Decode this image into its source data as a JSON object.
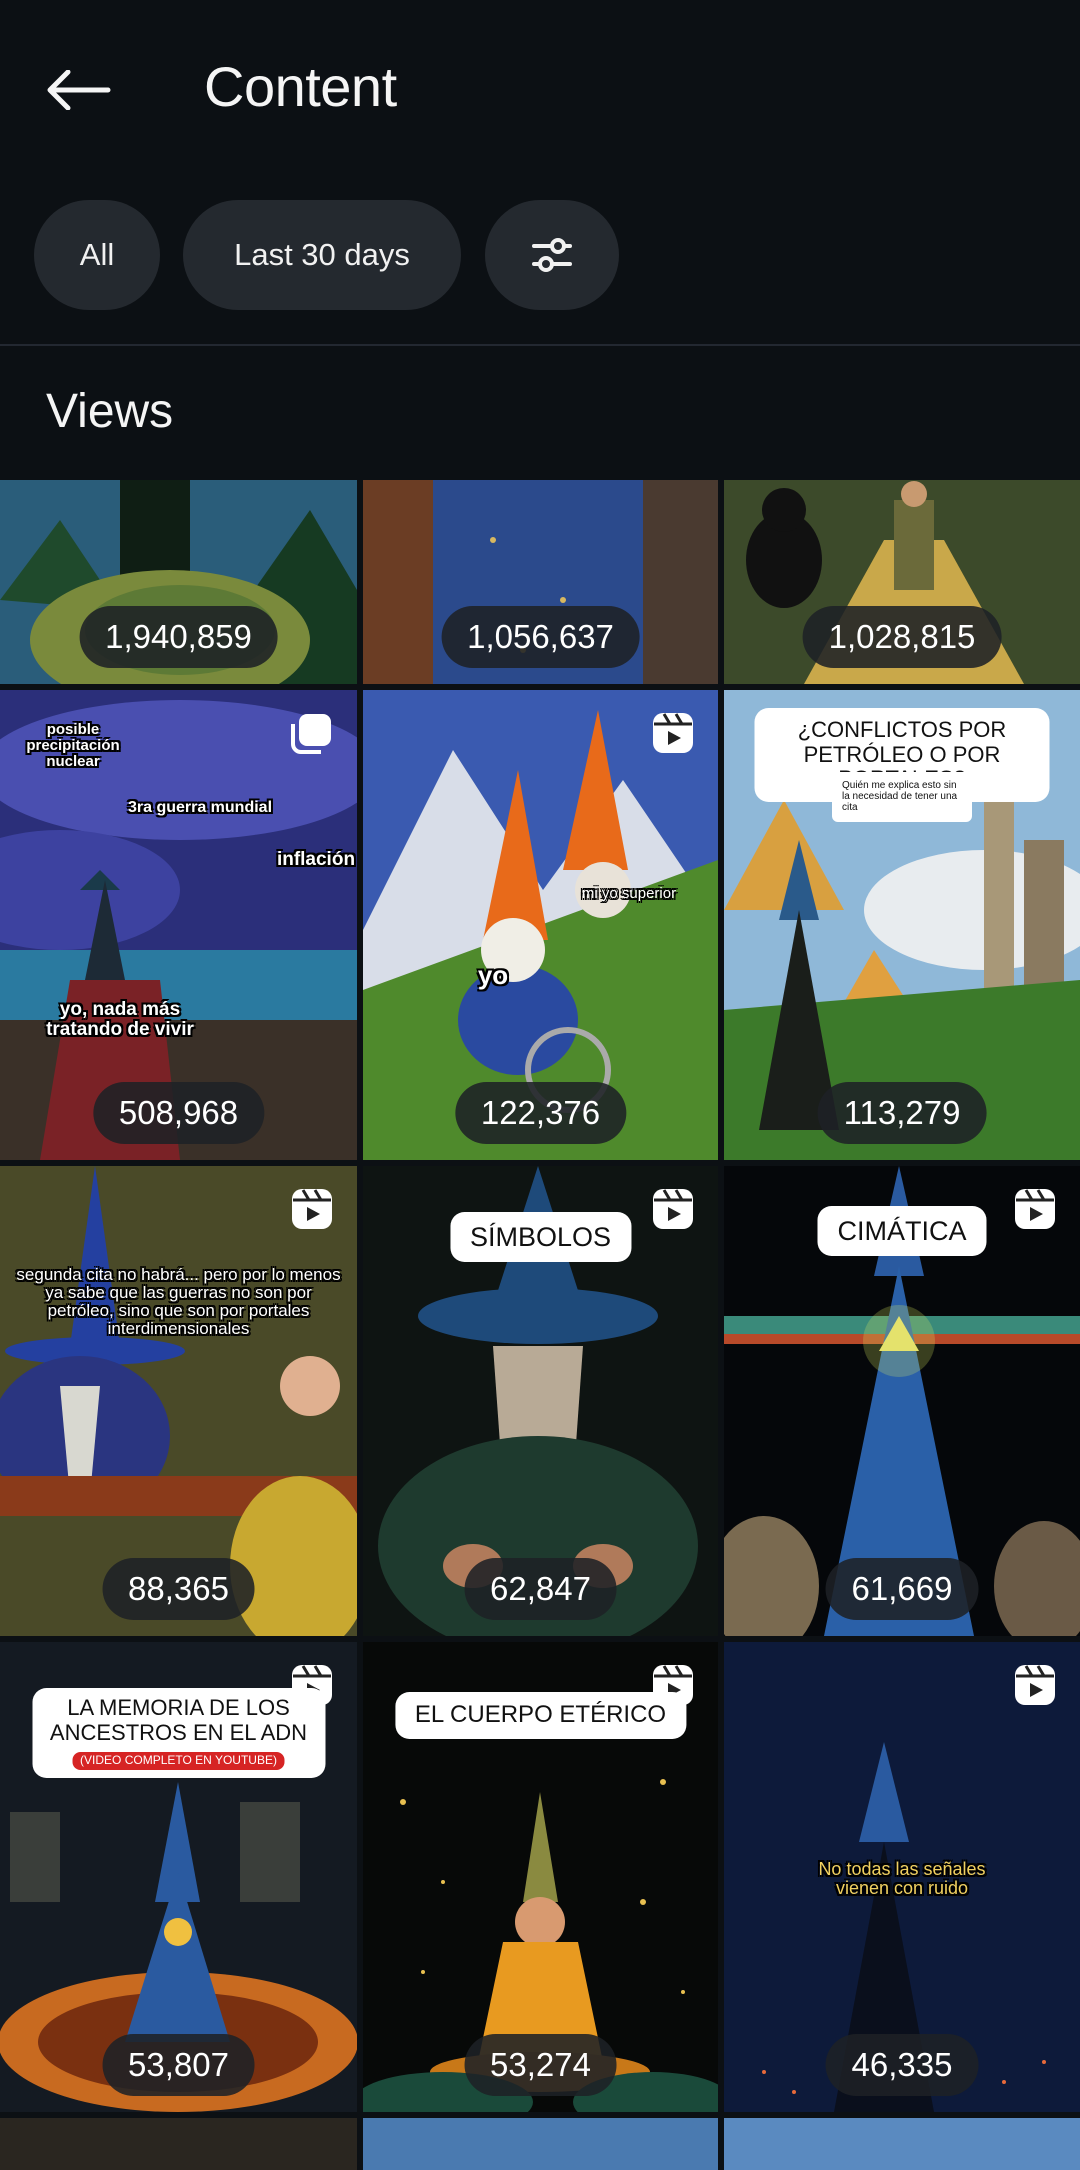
{
  "header": {
    "title": "Content"
  },
  "filters": {
    "all_label": "All",
    "date_label": "Last 30 days"
  },
  "section": {
    "title": "Views"
  },
  "posts": [
    {
      "views": "1,940,859"
    },
    {
      "views": "1,056,637"
    },
    {
      "views": "1,028,815"
    },
    {
      "views": "508,968",
      "texts": [
        "posible precipitación nuclear",
        "3ra guerra mundial",
        "inflación",
        "yo, nada más tratando de vivir"
      ]
    },
    {
      "views": "122,376",
      "texts": [
        "mi yo superior",
        "yo"
      ]
    },
    {
      "views": "113,279",
      "caption": "¿CONFLICTOS POR PETRÓLEO O POR PORTALES?",
      "comment": "Quién me explica esto sin la necesidad de tener una cita"
    },
    {
      "views": "88,365",
      "text": "segunda cita no habrá... pero por lo menos ya sabe que las guerras no son por petróleo, sino que son por portales interdimensionales"
    },
    {
      "views": "62,847",
      "caption": "SÍMBOLOS"
    },
    {
      "views": "61,669",
      "caption": "CIMÁTICA"
    },
    {
      "views": "53,807",
      "caption": "LA MEMORIA DE LOS ANCESTROS EN EL ADN",
      "subcaption": "(VIDEO COMPLETO EN YOUTUBE)"
    },
    {
      "views": "53,274",
      "caption": "EL CUERPO ETÉRICO"
    },
    {
      "views": "46,335",
      "text": "No todas las señales vienen con ruido"
    }
  ]
}
